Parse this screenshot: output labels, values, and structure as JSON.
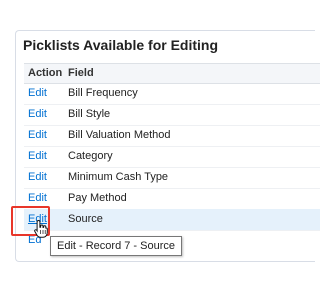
{
  "panel": {
    "title": "Picklists Available for Editing",
    "columns": {
      "action": "Action",
      "field": "Field"
    },
    "rows": [
      {
        "action": "Edit",
        "field": "Bill Frequency"
      },
      {
        "action": "Edit",
        "field": "Bill Style"
      },
      {
        "action": "Edit",
        "field": "Bill Valuation Method"
      },
      {
        "action": "Edit",
        "field": "Category"
      },
      {
        "action": "Edit",
        "field": "Minimum Cash Type"
      },
      {
        "action": "Edit",
        "field": "Pay Method"
      },
      {
        "action": "Edit",
        "field": "Source",
        "highlighted": true
      },
      {
        "action": "Ed",
        "field": ""
      }
    ]
  },
  "tooltip": {
    "text": "Edit - Record 7 - Source"
  },
  "colors": {
    "link": "#0070d2",
    "row_highlight": "#e5f1fb",
    "callout_border": "#e8362a"
  },
  "icons": {
    "cursor": "hand-pointer-icon"
  }
}
